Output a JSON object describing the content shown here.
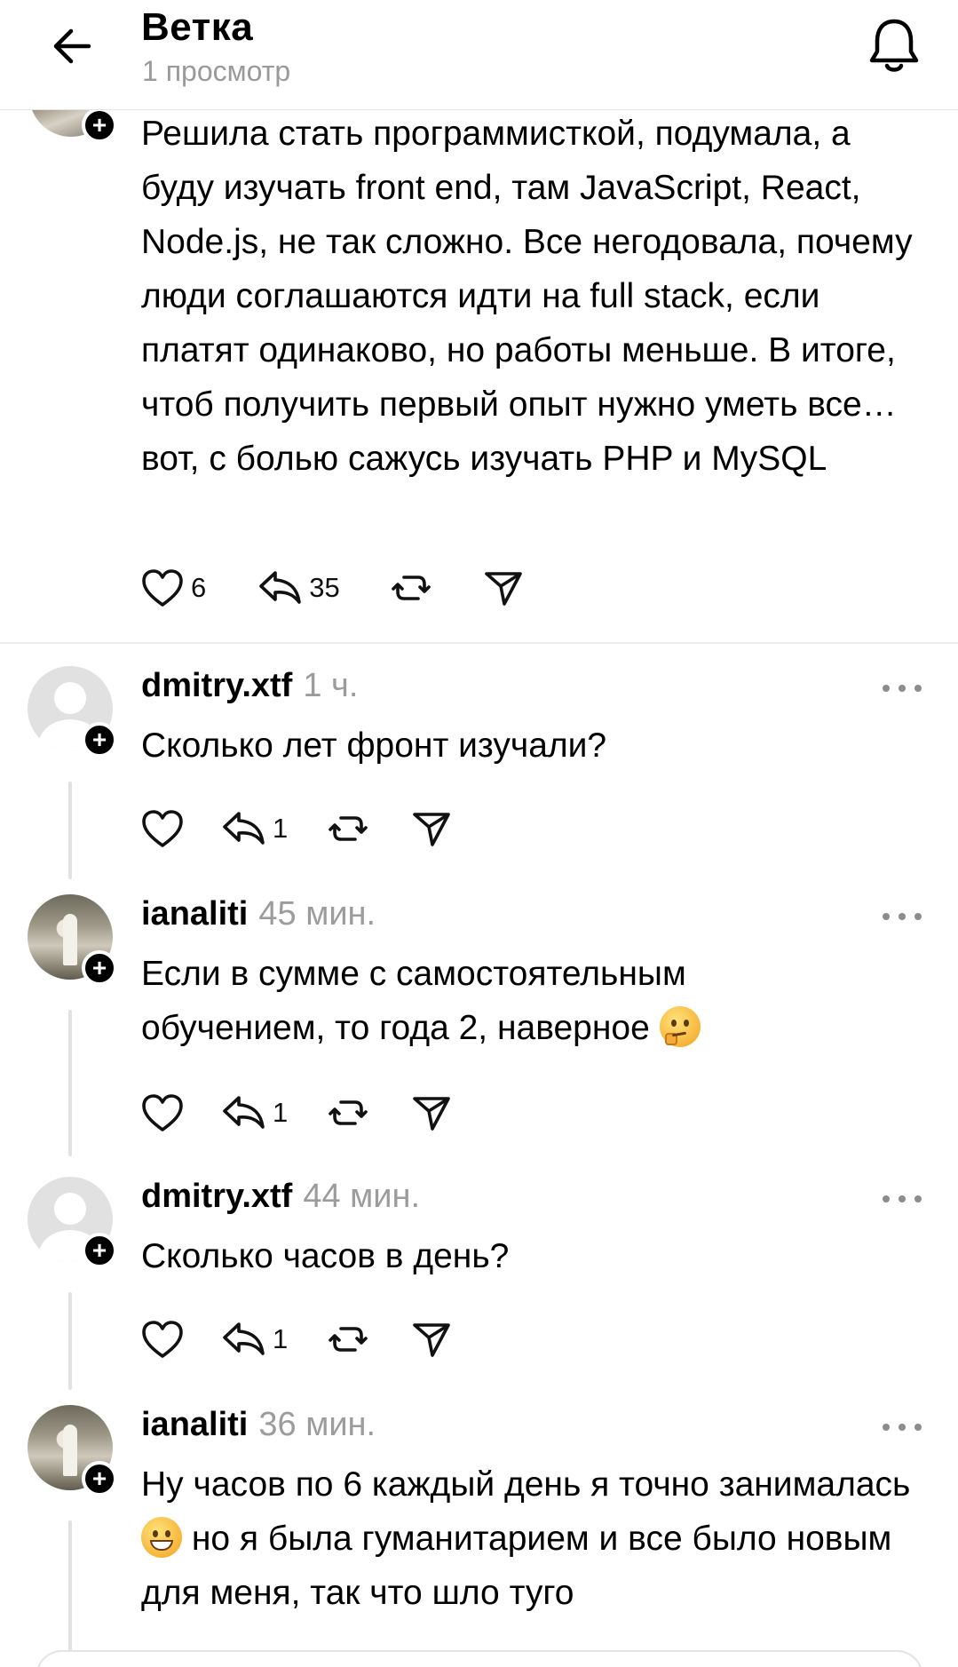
{
  "header": {
    "title": "Ветка",
    "subtitle": "1 просмотр"
  },
  "post": {
    "text": "Решила стать программисткой, подумала, а буду изучать front end, там JavaScript, React, Node.js, не так сложно. Все негодовала, почему люди соглашаются идти на full stack, если платят одинаково, но работы меньше. В итоге, чтоб получить первый опыт нужно уметь все… вот, с болью сажусь изучать PHP и MySQL",
    "likes": "6",
    "replies": "35"
  },
  "comments": [
    {
      "username": "dmitry.xtf",
      "time": "1 ч.",
      "text": "Сколько лет фронт изучали?",
      "replies": "1",
      "avatar": "default-avatar"
    },
    {
      "username": "ianaliti",
      "time": "45 мин.",
      "text_before": "Если в сумме с самостоятельным обучением, то года 2, наверное",
      "emoji": "thinking-face",
      "replies": "1",
      "avatar": "photo-avatar"
    },
    {
      "username": "dmitry.xtf",
      "time": "44 мин.",
      "text": "Сколько часов в день?",
      "replies": "1",
      "avatar": "default-avatar"
    },
    {
      "username": "ianaliti",
      "time": "36 мин.",
      "text_before": "Ну часов по 6 каждый день я точно занималась",
      "emoji": "grinning-face",
      "text_after": "но я была гуманитарием и все было новым для меня, так что шло туго",
      "avatar": "photo-avatar"
    }
  ],
  "icons": {
    "back": "arrow-left-icon",
    "bell": "bell-icon",
    "like": "heart-icon",
    "reply": "reply-icon",
    "repost": "repost-icon",
    "share": "send-icon",
    "more": "more-icon"
  }
}
